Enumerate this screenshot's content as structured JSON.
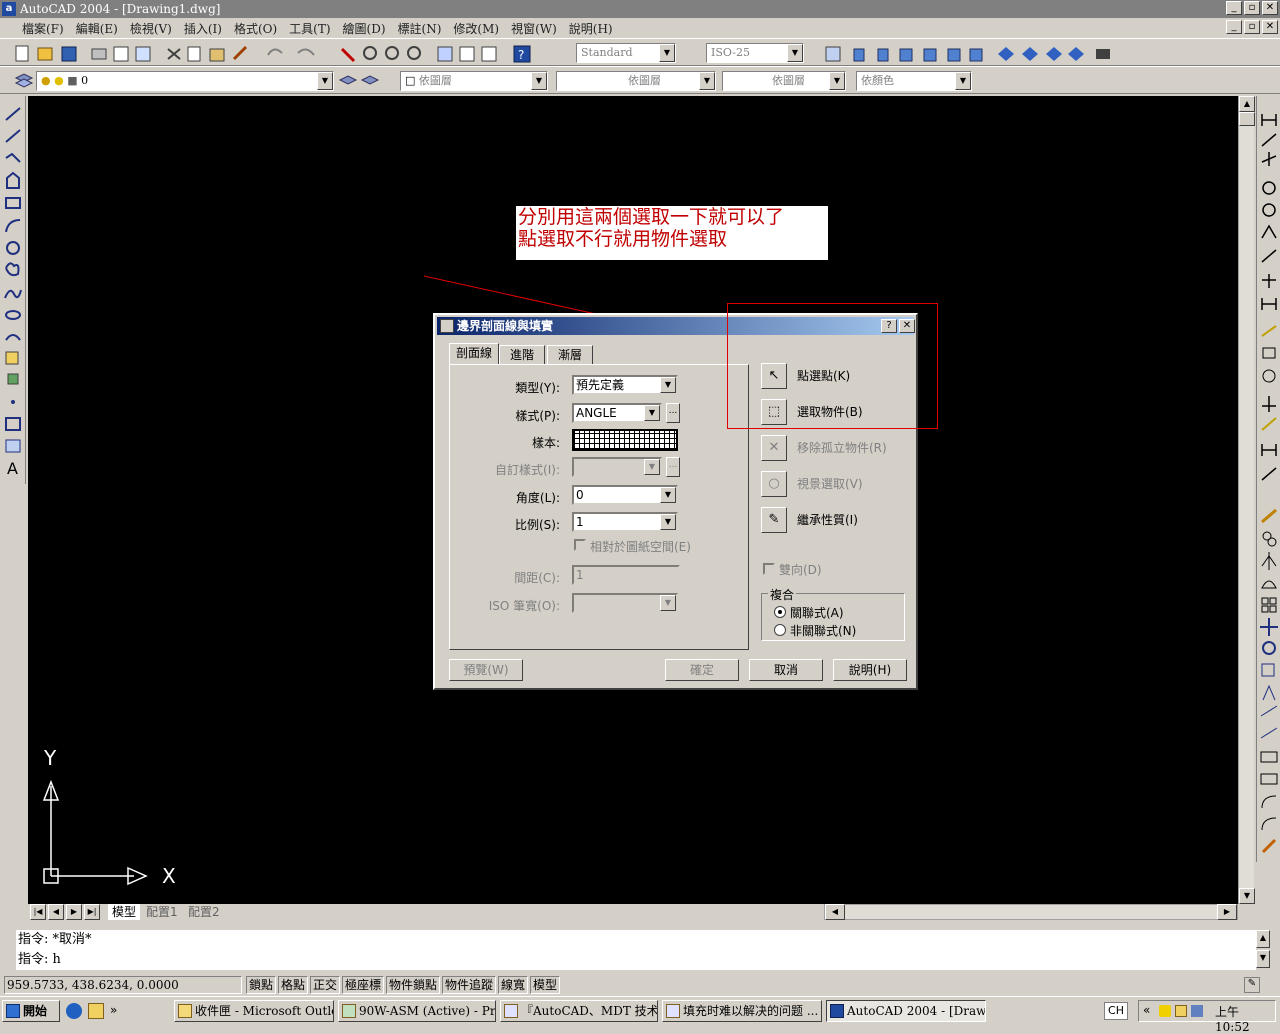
{
  "app": {
    "title": "AutoCAD 2004 - [Drawing1.dwg]",
    "icon_letter": "a"
  },
  "menu": [
    "檔案(F)",
    "編輯(E)",
    "檢視(V)",
    "插入(I)",
    "格式(O)",
    "工具(T)",
    "繪圖(D)",
    "標註(N)",
    "修改(M)",
    "視窗(W)",
    "說明(H)"
  ],
  "toolbar": {
    "text_style": "Standard",
    "dim_style": "ISO-25",
    "layer": "0",
    "color": "依圖層",
    "linetype": "依圖層",
    "lineweight": "依圖層",
    "plotstyle": "依顏色"
  },
  "annotation": {
    "line1": "分別用這兩個選取一下就可以了",
    "line2": "點選取不行就用物件選取"
  },
  "dialog": {
    "title": "邊界剖面線與填實",
    "tabs": [
      "剖面線",
      "進階",
      "漸層"
    ],
    "fields": {
      "type_label": "類型(Y):",
      "type_value": "預先定義",
      "pattern_label": "樣式(P):",
      "pattern_value": "ANGLE",
      "swatch_label": "樣本:",
      "custom_label": "自訂樣式(I):",
      "custom_value": "",
      "angle_label": "角度(L):",
      "angle_value": "0",
      "scale_label": "比例(S):",
      "scale_value": "1",
      "relative_label": "相對於圖紙空間(E)",
      "spacing_label": "間距(C):",
      "spacing_value": "1",
      "iso_label": "ISO 筆寬(O):",
      "iso_value": ""
    },
    "actions": {
      "pick_points": "點選點(K)",
      "select_objects": "選取物件(B)",
      "remove_islands": "移除孤立物件(R)",
      "view_selections": "視景選取(V)",
      "inherit": "繼承性質(I)"
    },
    "double_label": "雙向(D)",
    "composition": {
      "title": "複合",
      "associative": "關聯式(A)",
      "nonassociative": "非關聯式(N)"
    },
    "buttons": {
      "preview": "預覽(W)",
      "ok": "確定",
      "cancel": "取消",
      "help": "說明(H)"
    }
  },
  "ucs": {
    "x": "X",
    "y": "Y"
  },
  "layout_tabs": [
    "模型",
    "配置1",
    "配置2"
  ],
  "command": {
    "line1": "指令:  *取消*",
    "line2": "指令:  h"
  },
  "status": {
    "coords": "959.5733, 438.6234, 0.0000",
    "toggles": [
      "鎖點",
      "格點",
      "正交",
      "極座標",
      "物件鎖點",
      "物件追蹤",
      "線寬",
      "模型"
    ]
  },
  "taskbar": {
    "start": "開始",
    "tasks": [
      "收件匣 - Microsoft Outlook",
      "90W-ASM (Active) - Pro/...",
      "『AutoCAD、MDT 技术...",
      "填充时难以解决的问题 ...",
      "AutoCAD 2004 - [Drawin..."
    ],
    "lang": "CH",
    "clock": "上午 10:52"
  }
}
